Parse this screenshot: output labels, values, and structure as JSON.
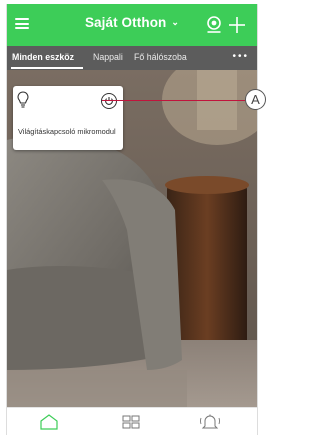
{
  "header": {
    "home_name": "Saját Otthon",
    "menu_icon": "hamburger-menu-icon",
    "add_icon": "plus-icon",
    "dropdown_icon": "chevron-down-icon",
    "location_icon": "location-pin-icon",
    "accent_color": "#3dcd58"
  },
  "tabs": [
    {
      "label": "Minden eszköz",
      "active": true
    },
    {
      "label": "Nappali",
      "active": false
    },
    {
      "label": "Fő hálószoba",
      "active": false
    }
  ],
  "more_icon": "more-dots-icon",
  "device_card": {
    "name": "Világításkapcsoló mikromodul",
    "device_icon": "light-bulb-icon",
    "power_icon": "power-icon"
  },
  "callout": {
    "letter": "A",
    "line_color": "#c0143c"
  },
  "bottom_nav": [
    {
      "name": "home",
      "icon": "home-icon",
      "active": true
    },
    {
      "name": "devices",
      "icon": "grid-icon",
      "active": false
    },
    {
      "name": "notifications",
      "icon": "bell-icon",
      "active": false
    }
  ]
}
